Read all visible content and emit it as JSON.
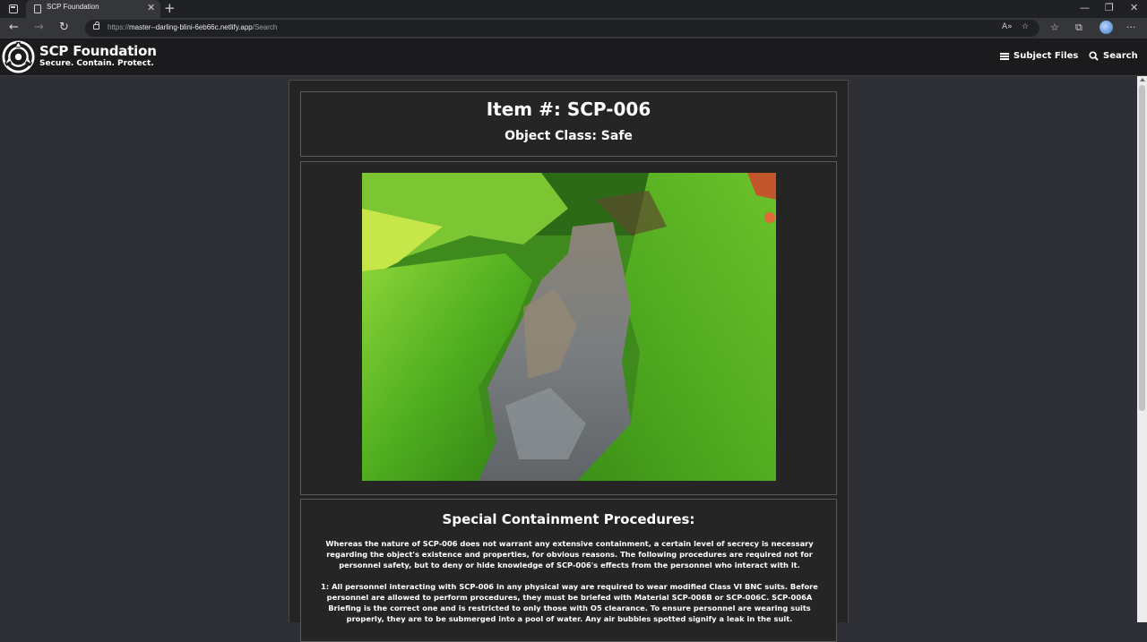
{
  "browser": {
    "tab_title": "SCP Foundation",
    "url_scheme": "https://",
    "url_host": "master--darling-blini-6eb66c.netlify.app",
    "url_path": "/Search"
  },
  "site": {
    "title": "SCP Foundation",
    "tagline": "Secure. Contain. Protect.",
    "nav": {
      "subject_files": "Subject Files",
      "search": "Search"
    }
  },
  "item": {
    "number": "Item #: SCP-006",
    "object_class": "Object Class: Safe",
    "image_icon": "stream-photo"
  },
  "procedures": {
    "heading": "Special Containment Procedures:",
    "paragraphs": [
      "Whereas the nature of SCP-006 does not warrant any extensive containment, a certain level of secrecy is necessary regarding the object's existence and properties, for obvious reasons. The following procedures are required not for personnel safety, but to deny or hide knowledge of SCP-006's effects from the personnel who interact with it.",
      "1: All personnel interacting with SCP-006 in any physical way are required to wear modified Class VI BNC suits. Before personnel are allowed to perform procedures, they must be briefed with Material SCP-006B or SCP-006C. SCP-006A Briefing is the correct one and is restricted to only those with O5 clearance. To ensure personnel are wearing suits properly, they are to be submerged into a pool of water. Any air bubbles spotted signify a leak in the suit."
    ]
  },
  "colors": {
    "page_bg": "#2f3036",
    "header_bg": "#1b1b1d",
    "panel_bg": "#252525",
    "panel_border": "#5a5a5a",
    "text": "#ffffff"
  }
}
